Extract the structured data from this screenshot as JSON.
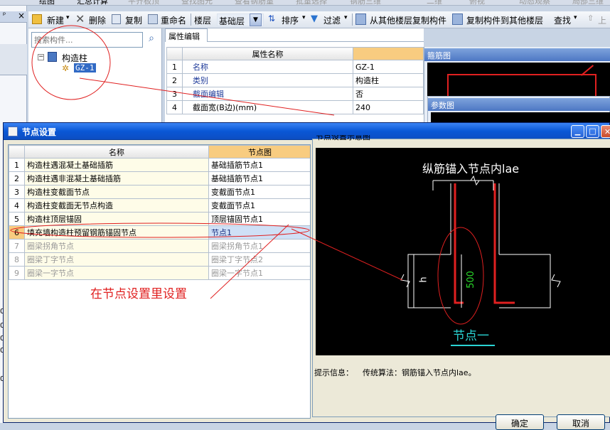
{
  "top_menu": [
    "绘图",
    "汇总计算",
    "平齐板顶",
    "查找图元",
    "查看钢筋量",
    "批量选择",
    "钢筋三维",
    "二维",
    "俯视",
    "动态观察",
    "局部三维"
  ],
  "toolbar": {
    "new": "新建",
    "delete": "删除",
    "copy": "复制",
    "rename": "重命名",
    "floor_label": "楼层",
    "floor_value": "基础层",
    "sort": "排序",
    "filter": "过滤",
    "copy_from": "从其他楼层复制构件",
    "copy_to": "复制构件到其他楼层",
    "find": "查找",
    "up": "上"
  },
  "left_strip": {
    "close": "×",
    "numbers": [
      "0",
      "0",
      "0",
      "0",
      "0"
    ]
  },
  "search": {
    "placeholder": "搜索构件..."
  },
  "tree": {
    "root": "构造柱",
    "child": "GZ-1"
  },
  "props": {
    "tab": "属性编辑",
    "header": "属性名称",
    "rows": [
      {
        "n": "1",
        "name": "名称",
        "value": "GZ-1"
      },
      {
        "n": "2",
        "name": "类别",
        "value": "构造柱"
      },
      {
        "n": "3",
        "name": "截面编辑",
        "value": "否"
      },
      {
        "n": "4",
        "name": "截面宽(B边)(mm)",
        "value": "240"
      }
    ]
  },
  "rebar_panel": {
    "title": "箍筋图"
  },
  "param_panel": {
    "title": "参数图"
  },
  "dialog": {
    "title": "节点设置",
    "col_name": "名称",
    "col_node": "节点图",
    "rows": [
      {
        "n": "1",
        "name": "构造柱遇混凝土基础插筋",
        "node": "基础插筋节点1",
        "gray": false
      },
      {
        "n": "2",
        "name": "构造柱遇非混凝土基础插筋",
        "node": "基础插筋节点1",
        "gray": false
      },
      {
        "n": "3",
        "name": "构造柱变截面节点",
        "node": "变截面节点1",
        "gray": false
      },
      {
        "n": "4",
        "name": "构造柱变截面无节点构造",
        "node": "变截面节点1",
        "gray": false
      },
      {
        "n": "5",
        "name": "构造柱顶层锚固",
        "node": "顶层锚固节点1",
        "gray": false
      },
      {
        "n": "6",
        "name": "填充墙构造柱预留钢筋锚固节点",
        "node": "节点1",
        "gray": false
      },
      {
        "n": "7",
        "name": "圈梁拐角节点",
        "node": "圈梁拐角节点1",
        "gray": true
      },
      {
        "n": "8",
        "name": "圈梁丁字节点",
        "node": "圈梁丁字节点2",
        "gray": true
      },
      {
        "n": "9",
        "name": "圈梁一字节点",
        "node": "圈梁一字节点1",
        "gray": true
      }
    ],
    "annotation": "在节点设置里设置",
    "preview_title": "节点设置示意图",
    "drawing": {
      "top": "纵筋锚入节点内lae",
      "dim_h": "h",
      "dim_500": "500",
      "caption": "节点一"
    },
    "hint_label": "提示信息：",
    "hint_text": "传统算法：钢筋锚入节点内lae。",
    "ok": "确定",
    "cancel": "取消"
  }
}
